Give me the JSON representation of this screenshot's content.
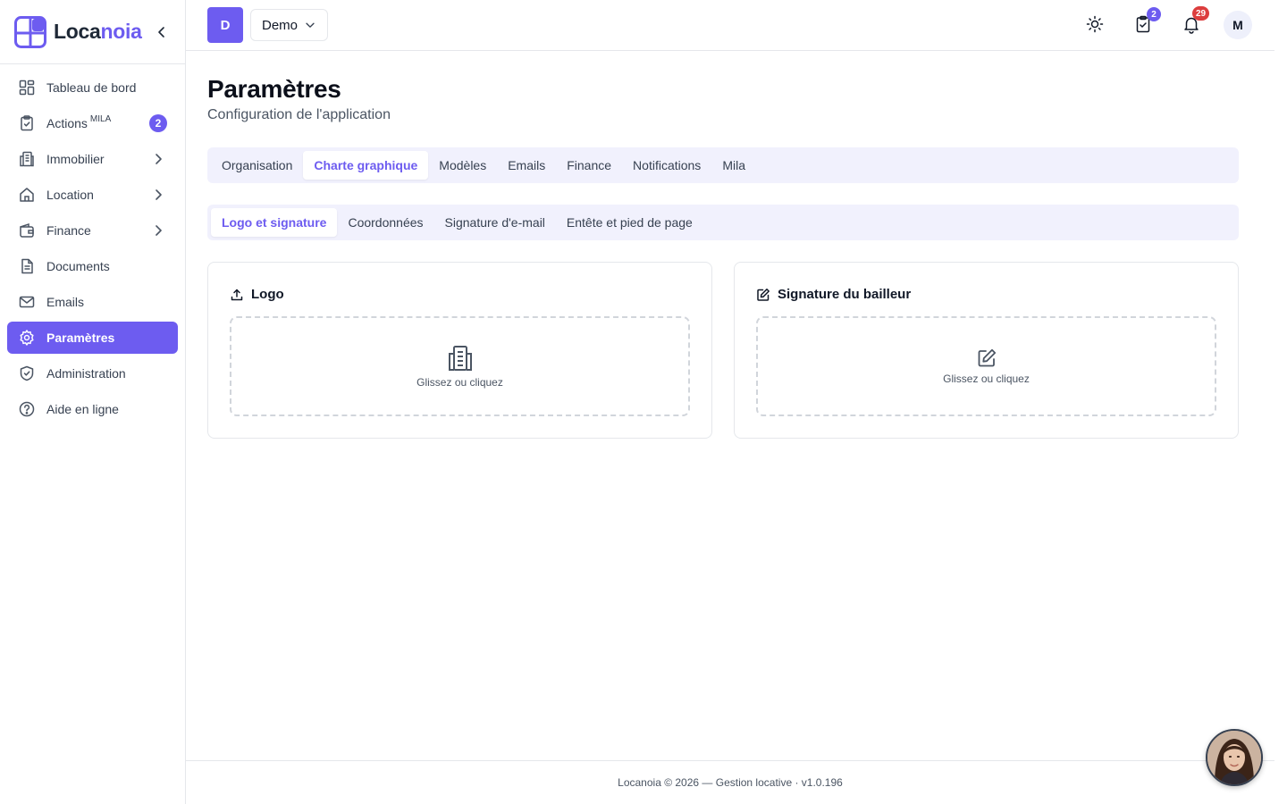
{
  "brand": {
    "name_part1": "Loca",
    "name_part2": "noia",
    "accent": "#6d5cf0"
  },
  "sidebar": {
    "items": [
      {
        "label": "Tableau de bord",
        "icon": "dashboard-icon"
      },
      {
        "label": "Actions",
        "sup": "MILA",
        "badge": "2",
        "icon": "clipboard-check-icon"
      },
      {
        "label": "Immobilier",
        "icon": "building-icon",
        "expandable": true
      },
      {
        "label": "Location",
        "icon": "home-icon",
        "expandable": true
      },
      {
        "label": "Finance",
        "icon": "wallet-icon",
        "expandable": true
      },
      {
        "label": "Documents",
        "icon": "document-icon"
      },
      {
        "label": "Emails",
        "icon": "mail-icon"
      },
      {
        "label": "Paramètres",
        "icon": "gear-icon",
        "active": true
      },
      {
        "label": "Administration",
        "icon": "shield-icon"
      },
      {
        "label": "Aide en ligne",
        "icon": "help-icon"
      }
    ]
  },
  "topbar": {
    "org_initial": "D",
    "org_name": "Demo",
    "tasks_badge": "2",
    "notifications_badge": "29",
    "user_initial": "M"
  },
  "page": {
    "title": "Paramètres",
    "subtitle": "Configuration de l'application"
  },
  "tabs": [
    {
      "label": "Organisation"
    },
    {
      "label": "Charte graphique",
      "active": true
    },
    {
      "label": "Modèles"
    },
    {
      "label": "Emails"
    },
    {
      "label": "Finance"
    },
    {
      "label": "Notifications"
    },
    {
      "label": "Mila"
    }
  ],
  "subtabs": [
    {
      "label": "Logo et signature",
      "active": true
    },
    {
      "label": "Coordonnées"
    },
    {
      "label": "Signature d'e-mail"
    },
    {
      "label": "Entête et pied de page"
    }
  ],
  "cards": {
    "logo": {
      "title": "Logo",
      "drop_text": "Glissez ou cliquez"
    },
    "signature": {
      "title": "Signature du bailleur",
      "drop_text": "Glissez ou cliquez"
    }
  },
  "footer": {
    "text": "Locanoia © 2026 — Gestion locative · v1.0.196"
  }
}
